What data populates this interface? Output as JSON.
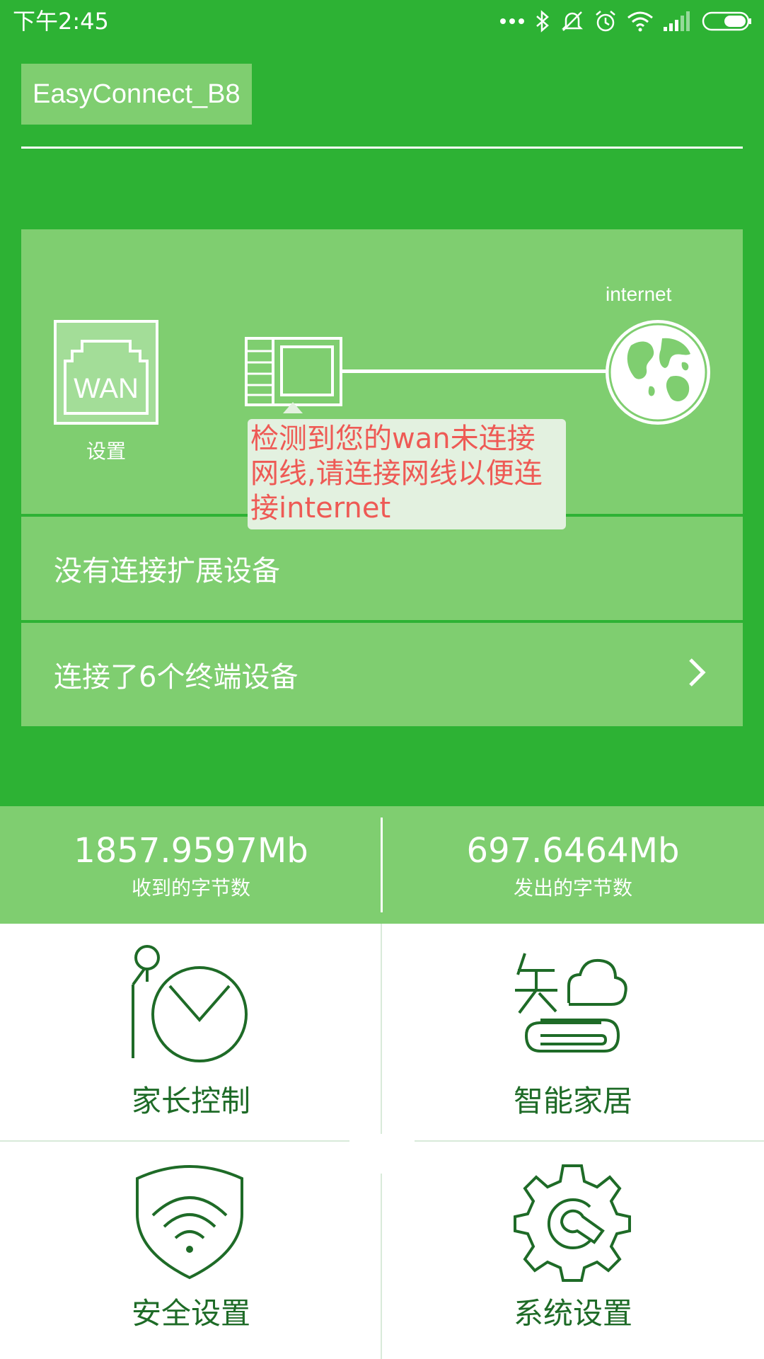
{
  "status_bar": {
    "time": "下午2:45"
  },
  "header": {
    "ssid": "EasyConnect_B8"
  },
  "diagram": {
    "wan_icon_text": "WAN",
    "wan_label": "设置",
    "globe_label": "internet",
    "warning": "检测到您的wan未连接网线,请连接网线以便连接internet"
  },
  "rows": {
    "extension": "没有连接扩展设备",
    "terminals": "连接了6个终端设备"
  },
  "stats": {
    "received_value": "1857.9597Mb",
    "received_label": "收到的字节数",
    "sent_value": "697.6464Mb",
    "sent_label": "发出的字节数"
  },
  "tiles": {
    "parental": "家长控制",
    "smart_home": "智能家居",
    "security": "安全设置",
    "system": "系统设置"
  },
  "colors": {
    "primary_green": "#2db234",
    "light_green": "#7fce70",
    "dark_green": "#1e6b27",
    "warning_red": "#ee5a55",
    "tooltip_bg": "#e3f1e0"
  },
  "icons": {
    "status": [
      "more-dots-icon",
      "bluetooth-icon",
      "silent-icon",
      "alarm-icon",
      "wifi-icon",
      "signal-icon",
      "battery-icon"
    ],
    "diagram": [
      "wan-port-icon",
      "router-icon",
      "globe-icon",
      "chevron-right-icon"
    ],
    "tiles": [
      "parental-clock-icon",
      "smart-home-icon",
      "security-shield-icon",
      "system-gear-icon"
    ]
  }
}
